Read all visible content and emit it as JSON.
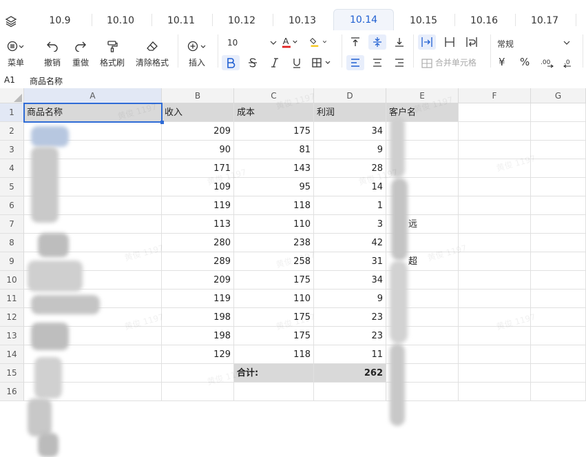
{
  "tabs": [
    "10.9",
    "10.10",
    "10.11",
    "10.12",
    "10.13",
    "10.14",
    "10.15",
    "10.16",
    "10.17"
  ],
  "active_tab": "10.14",
  "toolbar": {
    "menu_label": "菜单",
    "undo_label": "撤销",
    "redo_label": "重做",
    "format_painter_label": "格式刷",
    "clear_format_label": "清除格式",
    "insert_label": "插入",
    "font_size": "10",
    "number_format": "常规",
    "merge_label": "合并单元格",
    "currency_symbol": "¥",
    "percent_symbol": "%",
    "colors": {
      "font_color": "#e02020",
      "fill_color": "#f5c518",
      "active": "#1f5fd1"
    }
  },
  "formula_bar": {
    "cell_ref": "A1",
    "value": "商品名称"
  },
  "sheet": {
    "columns": [
      "A",
      "B",
      "C",
      "D",
      "E",
      "F",
      "G"
    ],
    "headers": {
      "a": "商品名称",
      "b": "收入",
      "c": "成本",
      "d": "利润",
      "e": "客户名"
    },
    "rows": [
      {
        "n": "1"
      },
      {
        "n": "2",
        "b": "209",
        "c": "175",
        "d": "34"
      },
      {
        "n": "3",
        "b": "90",
        "c": "81",
        "d": "9"
      },
      {
        "n": "4",
        "b": "171",
        "c": "143",
        "d": "28"
      },
      {
        "n": "5",
        "b": "109",
        "c": "95",
        "d": "14"
      },
      {
        "n": "6",
        "b": "119",
        "c": "118",
        "d": "1"
      },
      {
        "n": "7",
        "b": "113",
        "c": "110",
        "d": "3",
        "e_partial": "远"
      },
      {
        "n": "8",
        "b": "280",
        "c": "238",
        "d": "42"
      },
      {
        "n": "9",
        "b": "289",
        "c": "258",
        "d": "31",
        "e_partial": "超"
      },
      {
        "n": "10",
        "b": "209",
        "c": "175",
        "d": "34"
      },
      {
        "n": "11",
        "b": "119",
        "c": "110",
        "d": "9"
      },
      {
        "n": "12",
        "b": "198",
        "c": "175",
        "d": "23"
      },
      {
        "n": "13",
        "b": "198",
        "c": "175",
        "d": "23"
      },
      {
        "n": "14",
        "b": "129",
        "c": "118",
        "d": "11"
      },
      {
        "n": "15"
      },
      {
        "n": "16"
      }
    ],
    "total_label": "合计:",
    "total_value": "262"
  },
  "watermark": "黄俊 1197"
}
